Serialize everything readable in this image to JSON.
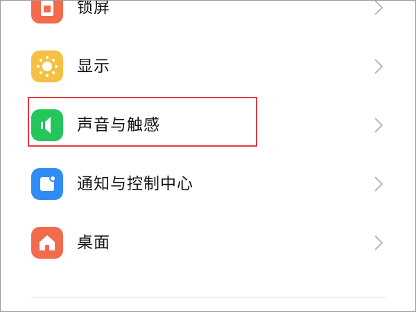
{
  "settings": {
    "items": [
      {
        "label": "锁屏",
        "icon": "lock-screen-icon",
        "color": "#f26b4d"
      },
      {
        "label": "显示",
        "icon": "sun-icon",
        "color": "#f6c142"
      },
      {
        "label": "声音与触感",
        "icon": "speaker-icon",
        "color": "#22c65b",
        "highlighted": true
      },
      {
        "label": "通知与控制中心",
        "icon": "notification-icon",
        "color": "#2f8cf5"
      },
      {
        "label": "桌面",
        "icon": "home-icon",
        "color": "#f26b4d"
      }
    ]
  },
  "highlight_color": "#e03a3a"
}
